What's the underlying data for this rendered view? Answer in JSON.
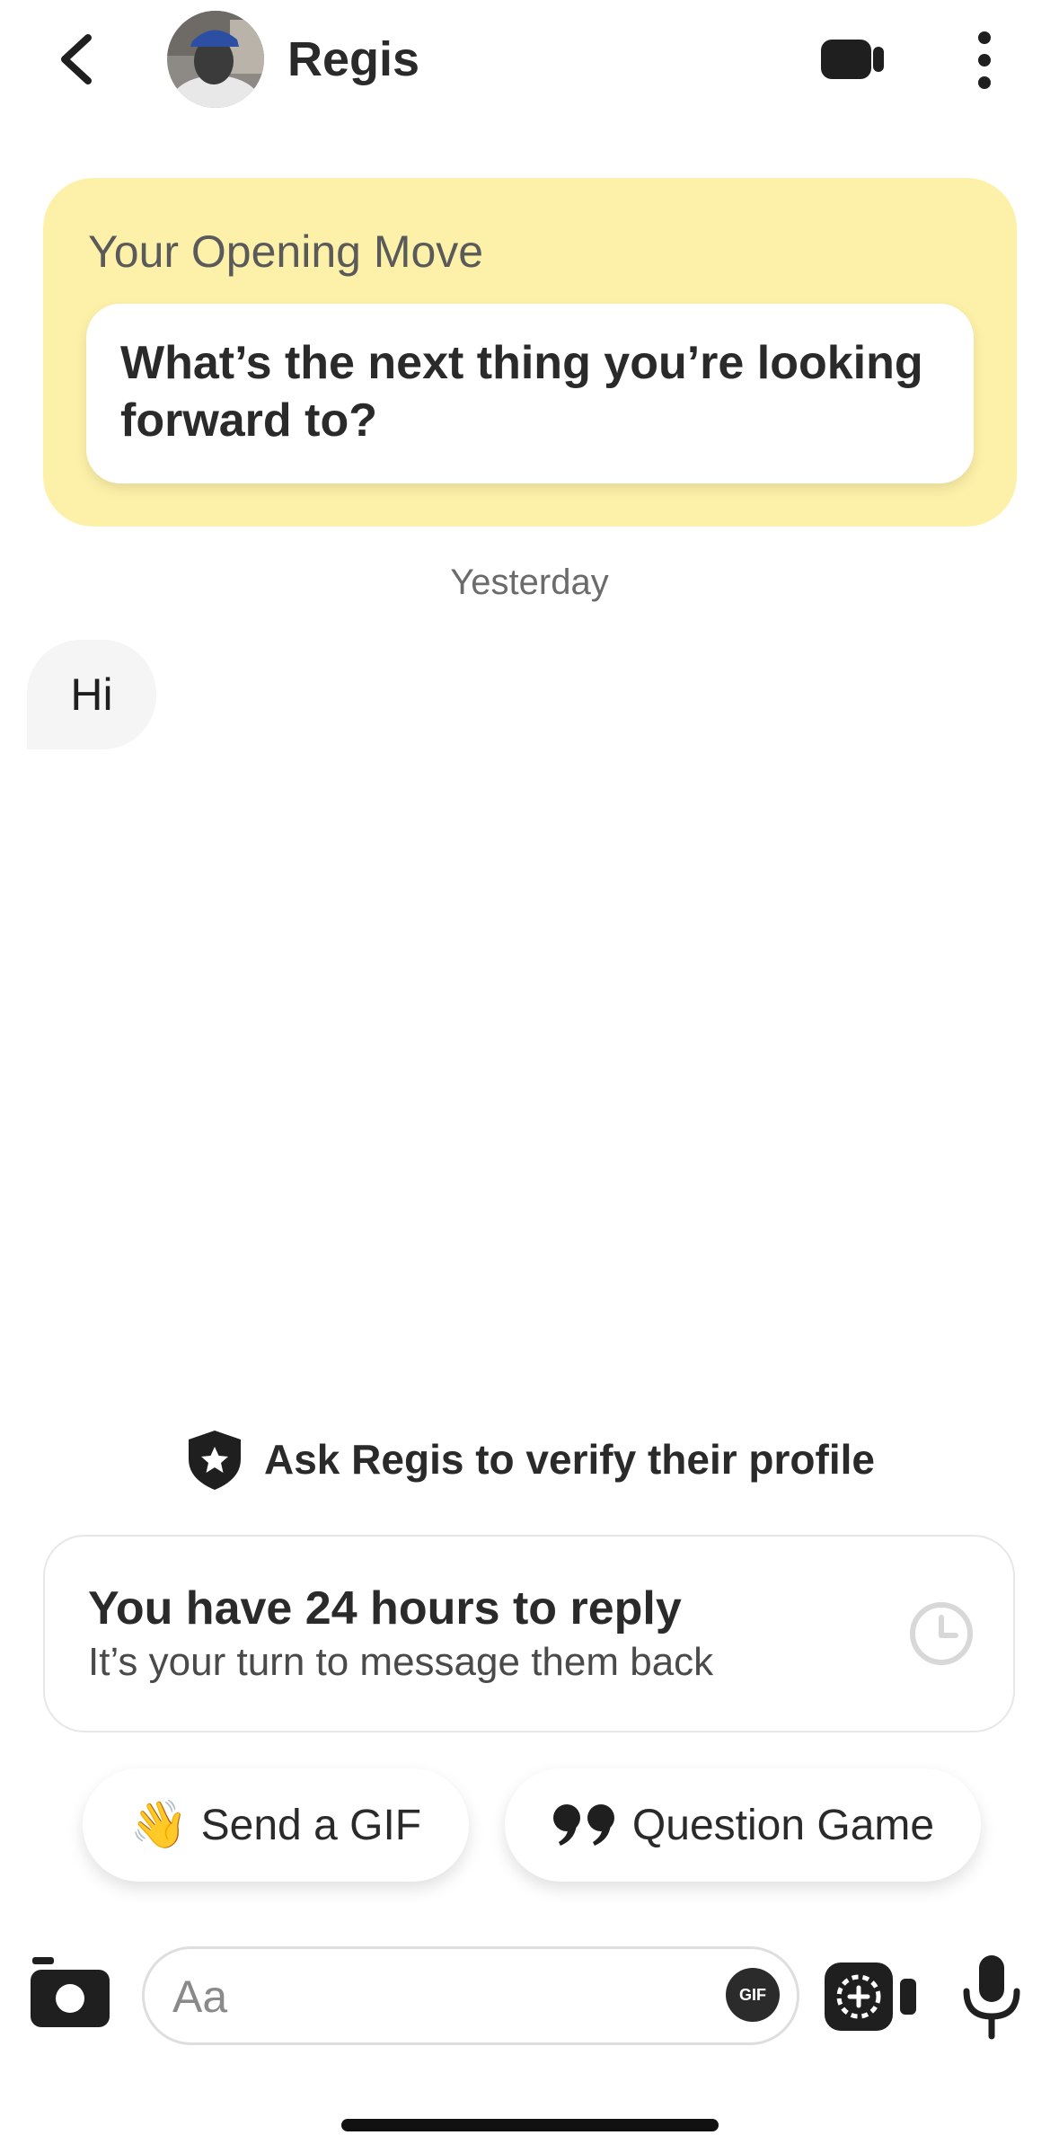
{
  "header": {
    "contact_name": "Regis"
  },
  "opening_move": {
    "title": "Your Opening Move",
    "question": "What’s the next thing you’re looking forward to?"
  },
  "conversation": {
    "date_separator": "Yesterday",
    "messages": [
      {
        "text": "Hi",
        "direction": "incoming"
      }
    ]
  },
  "verify": {
    "text": "Ask Regis to verify their profile"
  },
  "reply_notice": {
    "title": "You have 24 hours to reply",
    "subtitle": "It’s your turn to message them back"
  },
  "quick_actions": [
    {
      "emoji": "👋",
      "label": "Send a GIF"
    },
    {
      "label": "Question Game"
    }
  ],
  "composer": {
    "placeholder": "Aa",
    "gif_label": "GIF"
  },
  "colors": {
    "opening_move_bg": "#fdf1a9",
    "bubble_bg": "#f5f5f5"
  }
}
